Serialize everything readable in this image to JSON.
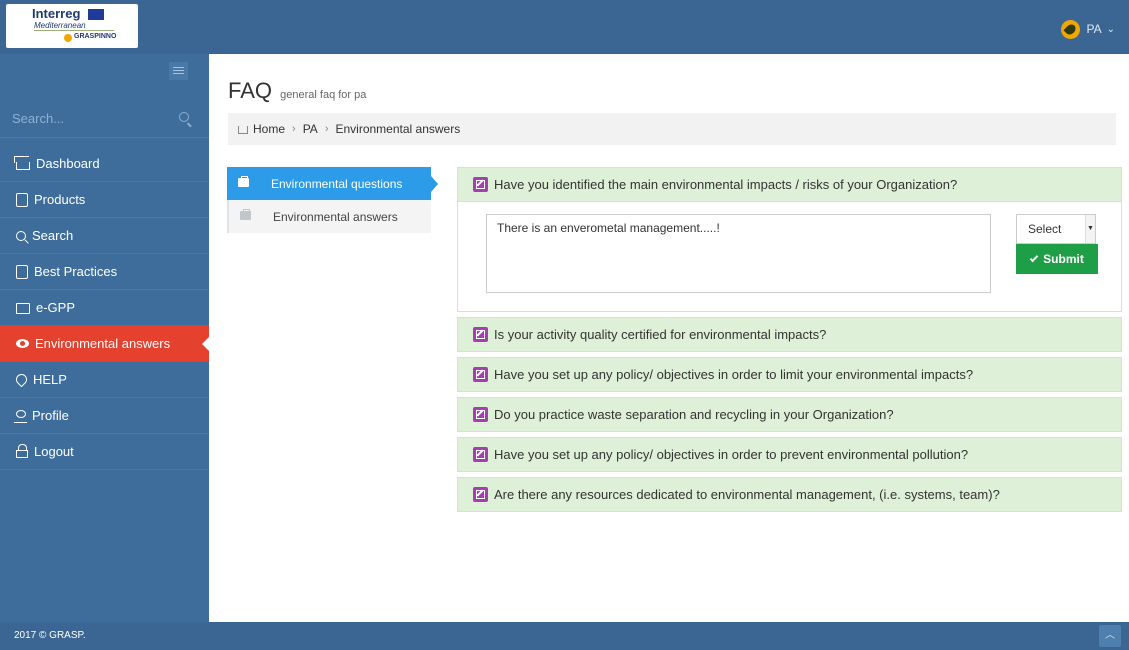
{
  "header": {
    "logo_text": "Interreg",
    "logo_sub": "Mediterranean",
    "logo_project": "GRASPINNO",
    "user_label": "PA",
    "accent": "#3b6693"
  },
  "sidebar": {
    "search_placeholder": "Search...",
    "items": [
      {
        "label": "Dashboard",
        "icon": "house-icon"
      },
      {
        "label": "Products",
        "icon": "document-icon"
      },
      {
        "label": "Search",
        "icon": "search-icon"
      },
      {
        "label": "Best Practices",
        "icon": "document-icon"
      },
      {
        "label": "e-GPP",
        "icon": "folder-icon"
      },
      {
        "label": "Environmental answers",
        "icon": "eye-icon",
        "active": true
      },
      {
        "label": "HELP",
        "icon": "pin-icon"
      },
      {
        "label": "Profile",
        "icon": "user-icon"
      },
      {
        "label": "Logout",
        "icon": "lock-icon"
      }
    ],
    "active_color": "#e4412f"
  },
  "page": {
    "title": "FAQ",
    "subtitle": "general faq for pa"
  },
  "breadcrumb": [
    "Home",
    "PA",
    "Environmental answers"
  ],
  "tabs": [
    {
      "label": "Environmental questions",
      "active": true
    },
    {
      "label": "Environmental answers",
      "active": false
    }
  ],
  "faq": {
    "questions": [
      "Have you identified the main environmental impacts / risks of your Organization?",
      "Is your activity quality certified for environmental impacts?",
      "Have you set up any policy/ objectives in order to limit your environmental impacts?",
      "Do you practice waste separation and recycling in your Organization?",
      "Have you set up any policy/ objectives in order to prevent environmental pollution?",
      "Are there any resources dedicated to environmental management, (i.e. systems, team)?"
    ],
    "answer_text": "There is an enverometal management.....!",
    "select_value": "Select",
    "submit_label": "Submit"
  },
  "footer": {
    "copyright": "2017 © GRASP."
  }
}
